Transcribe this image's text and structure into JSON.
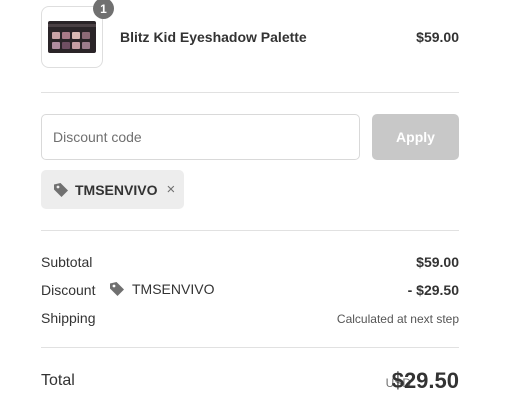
{
  "product": {
    "quantity": "1",
    "name": "Blitz Kid Eyeshadow Palette",
    "price": "$59.00",
    "image_icon": "eyeshadow-palette-thumbnail"
  },
  "discount": {
    "placeholder": "Discount code",
    "value": "",
    "apply_label": "Apply",
    "applied_code": "TMSENVIVO",
    "remove_icon": "×",
    "tag_icon": "tag-icon"
  },
  "summary": {
    "subtotal_label": "Subtotal",
    "subtotal_value": "$59.00",
    "discount_label": "Discount",
    "discount_code": "TMSENVIVO",
    "discount_value": "- $29.50",
    "shipping_label": "Shipping",
    "shipping_value": "Calculated at next step",
    "total_label": "Total",
    "currency": "USD",
    "total_value": "$29.50"
  },
  "colors": {
    "badge": "#707070",
    "apply_disabled": "#c8c8c8",
    "chip_bg": "#ededed",
    "text": "#333333"
  }
}
